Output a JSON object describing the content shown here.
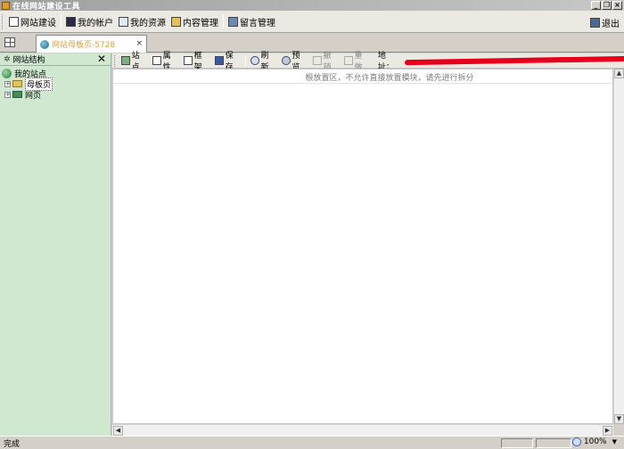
{
  "window": {
    "title": "在线网站建设工具",
    "controls": {
      "minimize": "_",
      "restore": "❐",
      "close": "×"
    }
  },
  "main_toolbar": {
    "items": [
      {
        "label": "网站建设",
        "icon": "site-build-icon"
      },
      {
        "label": "我的帐户",
        "icon": "account-icon"
      },
      {
        "label": "我的资源",
        "icon": "resources-icon"
      },
      {
        "label": "内容管理",
        "icon": "content-icon"
      },
      {
        "label": "留言管理",
        "icon": "message-icon"
      }
    ],
    "exit_label": "退出"
  },
  "tabs": [
    {
      "label": "网站母板页-5728",
      "close": "×"
    }
  ],
  "left_panel": {
    "title": "网站结构",
    "close": "✕",
    "tree": {
      "root": "我的站点",
      "children": [
        {
          "label": "母板页",
          "expander": "+"
        },
        {
          "label": "网页",
          "expander": "+"
        }
      ]
    }
  },
  "editor_toolbar": {
    "buttons": [
      {
        "label": "站点",
        "icon": "site-icon",
        "enabled": true
      },
      {
        "label": "属性",
        "icon": "properties-icon",
        "enabled": true
      },
      {
        "label": "框架",
        "icon": "frame-icon",
        "enabled": true
      },
      {
        "label": "保存",
        "icon": "save-icon",
        "enabled": true
      },
      {
        "label": "刷新",
        "icon": "refresh-icon",
        "enabled": true
      },
      {
        "label": "预览",
        "icon": "preview-icon",
        "enabled": true
      },
      {
        "label": "撤销",
        "icon": "undo-icon",
        "enabled": false
      },
      {
        "label": "重做",
        "icon": "redo-icon",
        "enabled": false
      }
    ],
    "address_label": "地址："
  },
  "canvas": {
    "hint": "根放置区，不允许直接放置模块，请先进行拆分"
  },
  "status_bar": {
    "status": "完成",
    "zoom": "100%"
  },
  "colors": {
    "left_panel_bg": "#d0e8d0",
    "tab_label": "#d4a040",
    "redaction": "#e8001a"
  }
}
